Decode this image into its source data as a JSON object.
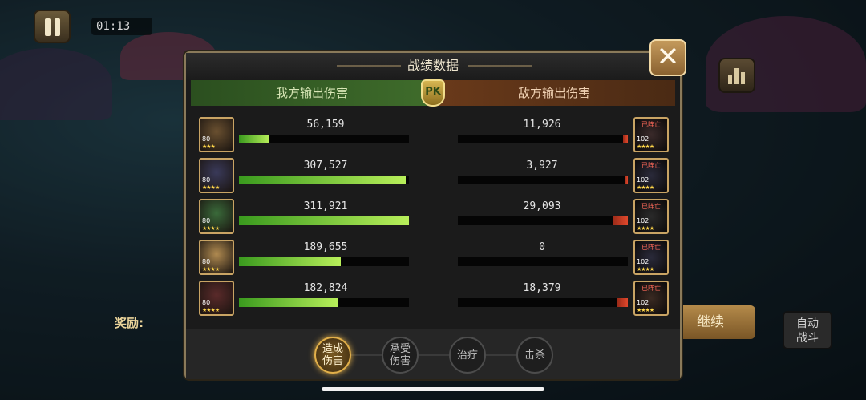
{
  "hud": {
    "timer": "01:13"
  },
  "panel": {
    "title": "战绩数据",
    "close_symbol": "✕",
    "left_header": "我方输出伤害",
    "right_header": "敌方输出伤害",
    "pk_badge": "PK"
  },
  "allies": [
    {
      "damage": "56,159",
      "fill": 0.18,
      "level": "80",
      "stars": "★★★",
      "portrait": "#6a5030"
    },
    {
      "damage": "307,527",
      "fill": 0.98,
      "level": "80",
      "stars": "★★★★",
      "portrait": "#3a3a5a"
    },
    {
      "damage": "311,921",
      "fill": 1.0,
      "level": "80",
      "stars": "★★★★",
      "portrait": "#3a6a3a"
    },
    {
      "damage": "189,655",
      "fill": 0.6,
      "level": "80",
      "stars": "★★★★",
      "portrait": "#b08a50"
    },
    {
      "damage": "182,824",
      "fill": 0.58,
      "level": "80",
      "stars": "★★★★",
      "portrait": "#5a2a2a"
    }
  ],
  "enemies": [
    {
      "damage": "11,926",
      "fill": 0.03,
      "level": "102",
      "status": "已阵亡",
      "stars": "★★★★",
      "portrait": "#3a2a2a"
    },
    {
      "damage": "3,927",
      "fill": 0.01,
      "level": "102",
      "status": "已阵亡",
      "stars": "★★★★",
      "portrait": "#2a2a3a"
    },
    {
      "damage": "29,093",
      "fill": 0.09,
      "level": "102",
      "status": "已阵亡",
      "stars": "★★★★",
      "portrait": "#2a2a2a"
    },
    {
      "damage": "0",
      "fill": 0.0,
      "level": "102",
      "status": "已阵亡",
      "stars": "★★★★",
      "portrait": "#2a2a3a"
    },
    {
      "damage": "18,379",
      "fill": 0.06,
      "level": "102",
      "status": "已阵亡",
      "stars": "★★★★",
      "portrait": "#3a2a22"
    }
  ],
  "tabs": [
    {
      "label": "造成伤害",
      "active": true
    },
    {
      "label": "承受伤害",
      "active": false
    },
    {
      "label": "治疗",
      "active": false
    },
    {
      "label": "击杀",
      "active": false
    }
  ],
  "background": {
    "reward_label": "奖励:",
    "continue_label": "继续",
    "auto_battle_label": "自动战斗"
  },
  "colors": {
    "ally_bar": "#9adf4a",
    "enemy_bar": "#d8402a",
    "gold": "#e2b04a"
  }
}
